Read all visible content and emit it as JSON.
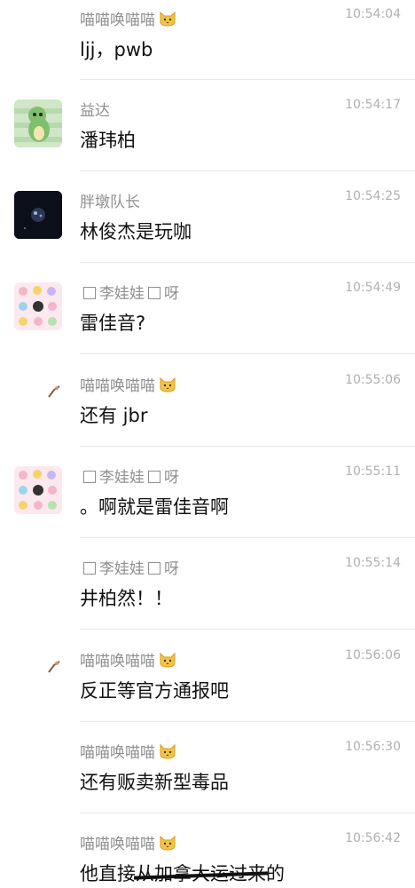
{
  "cat_emoji": "cat-face-icon",
  "messages": [
    {
      "name": "喵喵唤喵喵",
      "time": "10:54:04",
      "text": "ljj，pwb"
    },
    {
      "name": "益达",
      "time": "10:54:17",
      "text": "潘玮柏"
    },
    {
      "name": "胖墩队长",
      "time": "10:54:25",
      "text": "林俊杰是玩咖"
    },
    {
      "name": "李娃娃",
      "name_suffix": "呀",
      "time": "10:54:49",
      "text": "雷佳音?"
    },
    {
      "name": "喵喵唤喵喵",
      "time": "10:55:06",
      "text": "还有 jbr"
    },
    {
      "name": "李娃娃",
      "name_suffix": "呀",
      "time": "10:55:11",
      "text": "。啊就是雷佳音啊"
    },
    {
      "name": "李娃娃",
      "name_suffix": "呀",
      "time": "10:55:14",
      "text": "井柏然！！"
    },
    {
      "name": "喵喵唤喵喵",
      "time": "10:56:06",
      "text": "反正等官方通报吧"
    },
    {
      "name": "喵喵唤喵喵",
      "time": "10:56:30",
      "text": "还有贩卖新型毒品"
    },
    {
      "name": "喵喵唤喵喵",
      "time": "10:56:42",
      "text_prefix": "他直接",
      "text_struck": "从加拿大运过来",
      "text_suffix": "的"
    }
  ]
}
